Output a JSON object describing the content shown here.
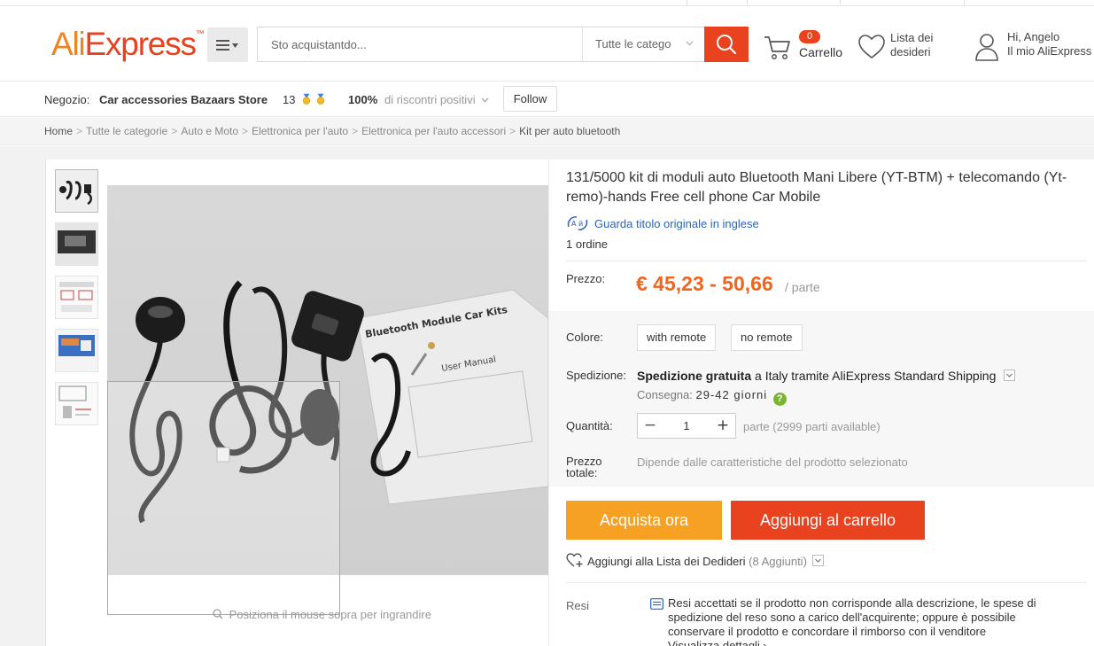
{
  "header": {
    "logo_main": "AliExpress",
    "logo_mark": "™",
    "search_placeholder": "Sto acquistantdo...",
    "search_category": "Tutte le catego",
    "cart_count": "0",
    "cart_label": "Carrello",
    "wishlist_line1": "Lista dei",
    "wishlist_line2": "desideri",
    "user_line1": "Hi, Angelo",
    "user_line2": "Il mio AliExpress",
    "icons": {
      "menu": "menu-icon",
      "search": "search-icon",
      "cart": "cart-icon",
      "wishlist": "heart-icon",
      "user": "user-icon"
    }
  },
  "store": {
    "label": "Negozio:",
    "name": "Car accessories Bazaars Store",
    "score": "13",
    "rating": "100%",
    "rating_label": "di riscontri positivi",
    "follow": "Follow"
  },
  "breadcrumb": {
    "items": [
      "Home",
      "Tutte le categorie",
      "Auto e Moto",
      "Elettronica per l'auto",
      "Elettronica per l'auto accessori"
    ],
    "current": "Kit per auto bluetooth",
    "separator": ">"
  },
  "gallery": {
    "box_text": "Bluetooth Module Car Kits",
    "manual_text": "User Manual",
    "hover_hint": "Posiziona il mouse sopra per ingrandire"
  },
  "product": {
    "title": "131/5000 kit di moduli auto Bluetooth Mani Libere (YT-BTM) + telecomando (Yt-remo)-hands Free cell phone Car Mobile",
    "original_title_link": "Guarda titolo originale in inglese",
    "orders": "1 ordine",
    "price_label": "Prezzo:",
    "price": "€ 45,23 - 50,66",
    "price_unit": "/ parte",
    "color_label": "Colore:",
    "color_options": [
      "with remote",
      "no remote"
    ],
    "shipping_label": "Spedizione:",
    "shipping_bold": "Spedizione gratuita",
    "shipping_rest": " a Italy tramite AliExpress Standard Shipping",
    "delivery_label": "Consegna:",
    "delivery_days": "29-42 giorni",
    "delivery_help": "?",
    "quantity_label": "Quantità:",
    "quantity_value": "1",
    "quantity_minus": "−",
    "quantity_plus": "+",
    "quantity_available": "parte (2999 parti available)",
    "total_label_line1": "Prezzo",
    "total_label_line2": "totale:",
    "total_value": "Dipende dalle caratteristiche del prodotto selezionato",
    "buy_now": "Acquista ora",
    "add_to_cart": "Aggiungi al carrello",
    "wishlist_add": "Aggiungi alla Lista dei Dedideri",
    "wishlist_count": "(8 Aggiunti)",
    "returns_label": "Resi",
    "returns_text": "Resi accettati se il prodotto non corrisponde alla descrizione, le spese di spedizione del reso sono a carico dell'acquirente; oppure è possibile conservare il prodotto e concordare il rimborso con il venditore",
    "returns_more": "Visualizza dettagli ›"
  },
  "colors": {
    "brand_orange": "#f0841e",
    "brand_red": "#e8421e",
    "price": "#f0641e",
    "buy_now": "#f6a123",
    "link_blue": "#2c64b8"
  }
}
